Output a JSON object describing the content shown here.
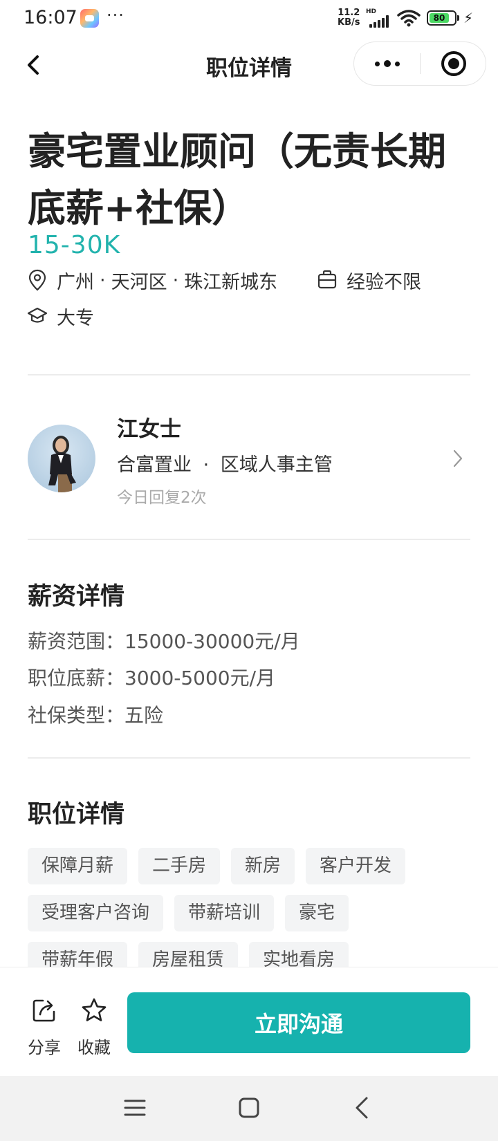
{
  "status_bar": {
    "time": "16:07",
    "more": "···",
    "net_speed_value": "11.2",
    "net_speed_unit": "KB/s",
    "hd_label": "HD",
    "battery_level": "80",
    "battery_color": "#4cd964"
  },
  "nav": {
    "title": "职位详情",
    "back_icon": "chevron-left-icon",
    "more_icon": "more-dots-icon",
    "close_icon": "target-circle-icon"
  },
  "job": {
    "title": "豪宅置业顾问（无责长期底薪+社保）",
    "salary": "15-30K",
    "salary_color": "#22b3ad",
    "location": {
      "city": "广州",
      "district": "天河区",
      "area": "珠江新城东",
      "separator": "·"
    },
    "experience": "经验不限",
    "education": "大专"
  },
  "recruiter": {
    "name": "江女士",
    "company": "合富置业",
    "role": "区域人事主管",
    "separator": "·",
    "reply_info": "今日回复2次"
  },
  "salary_details": {
    "title": "薪资详情",
    "lines": [
      "薪资范围：15000-30000元/月",
      "职位底薪：3000-5000元/月",
      "社保类型：五险"
    ]
  },
  "job_details": {
    "title": "职位详情",
    "tags": [
      "保障月薪",
      "二手房",
      "新房",
      "客户开发",
      "受理客户咨询",
      "带薪培训",
      "豪宅",
      "带薪年假",
      "房屋租赁",
      "实地看房"
    ]
  },
  "actions": {
    "share_label": "分享",
    "favorite_label": "收藏",
    "chat_label": "立即沟通",
    "chat_color": "#16b2ae"
  }
}
